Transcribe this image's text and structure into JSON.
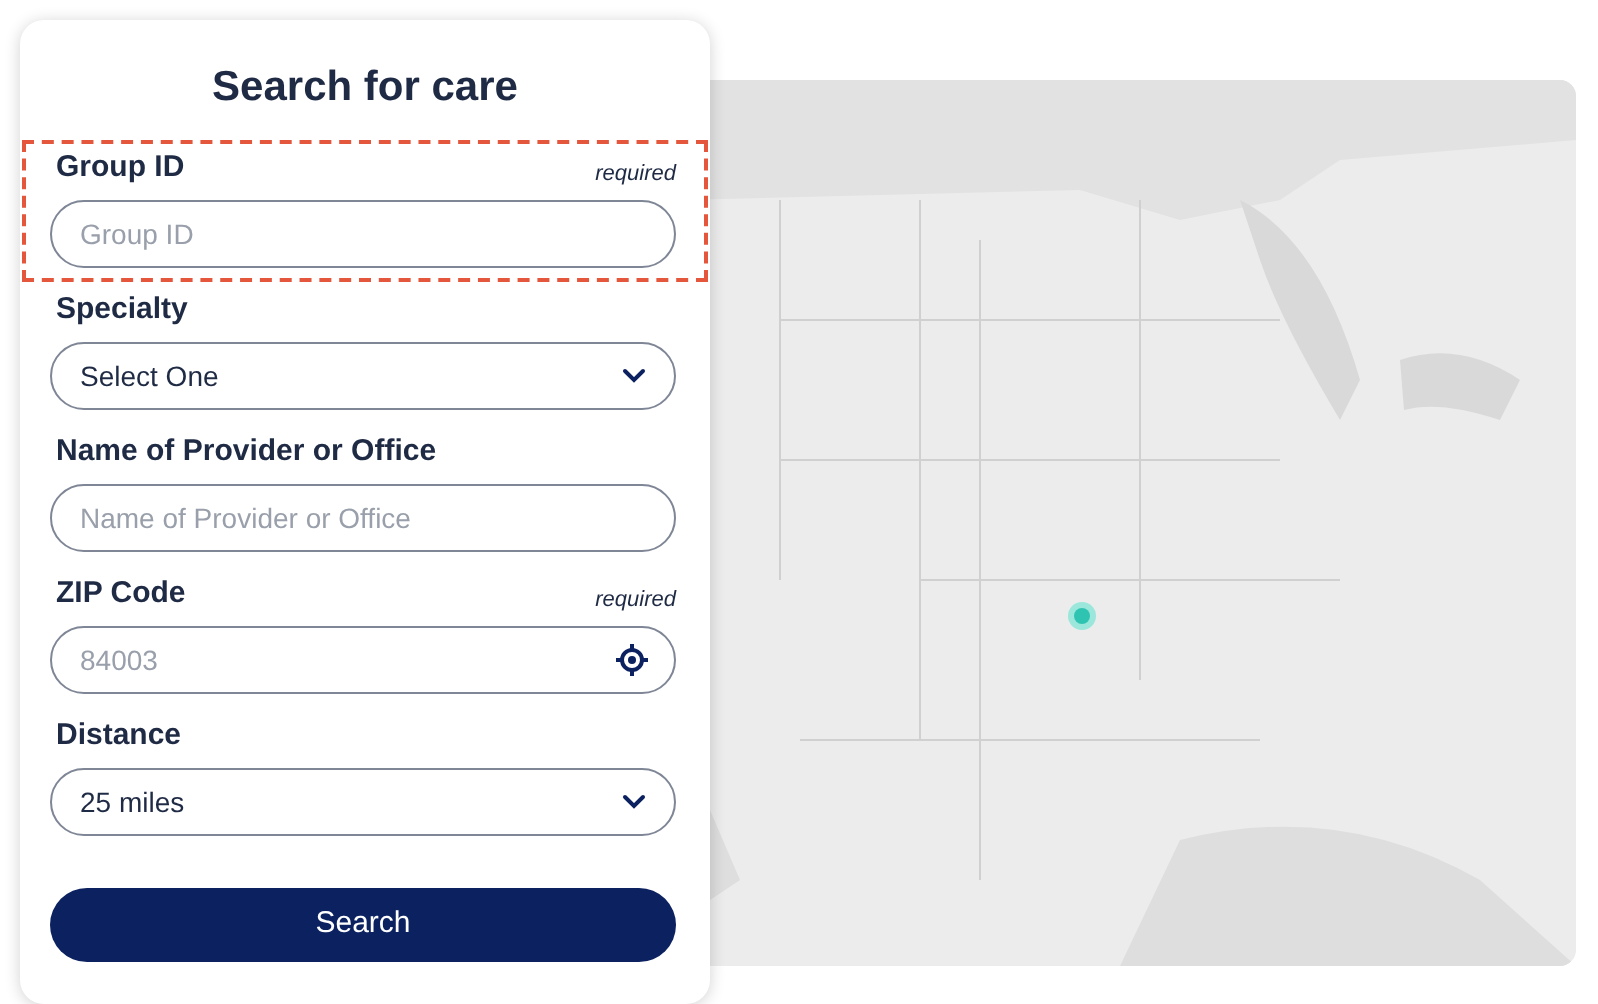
{
  "title": "Search for care",
  "fields": [
    {
      "kind": "text",
      "label": "Group ID",
      "note": "required",
      "highlighted": true,
      "placeholder": "Group ID"
    },
    {
      "kind": "select",
      "label": "Specialty",
      "highlighted": false,
      "value": "Select One"
    },
    {
      "kind": "text",
      "label": "Name of Provider or Office",
      "highlighted": false,
      "placeholder": "Name of Provider or Office"
    },
    {
      "kind": "location",
      "label": "ZIP Code",
      "note": "required",
      "highlighted": false,
      "placeholder": "84003"
    },
    {
      "kind": "select",
      "label": "Distance",
      "highlighted": false,
      "value": "25 miles"
    }
  ],
  "search_button": "Search"
}
